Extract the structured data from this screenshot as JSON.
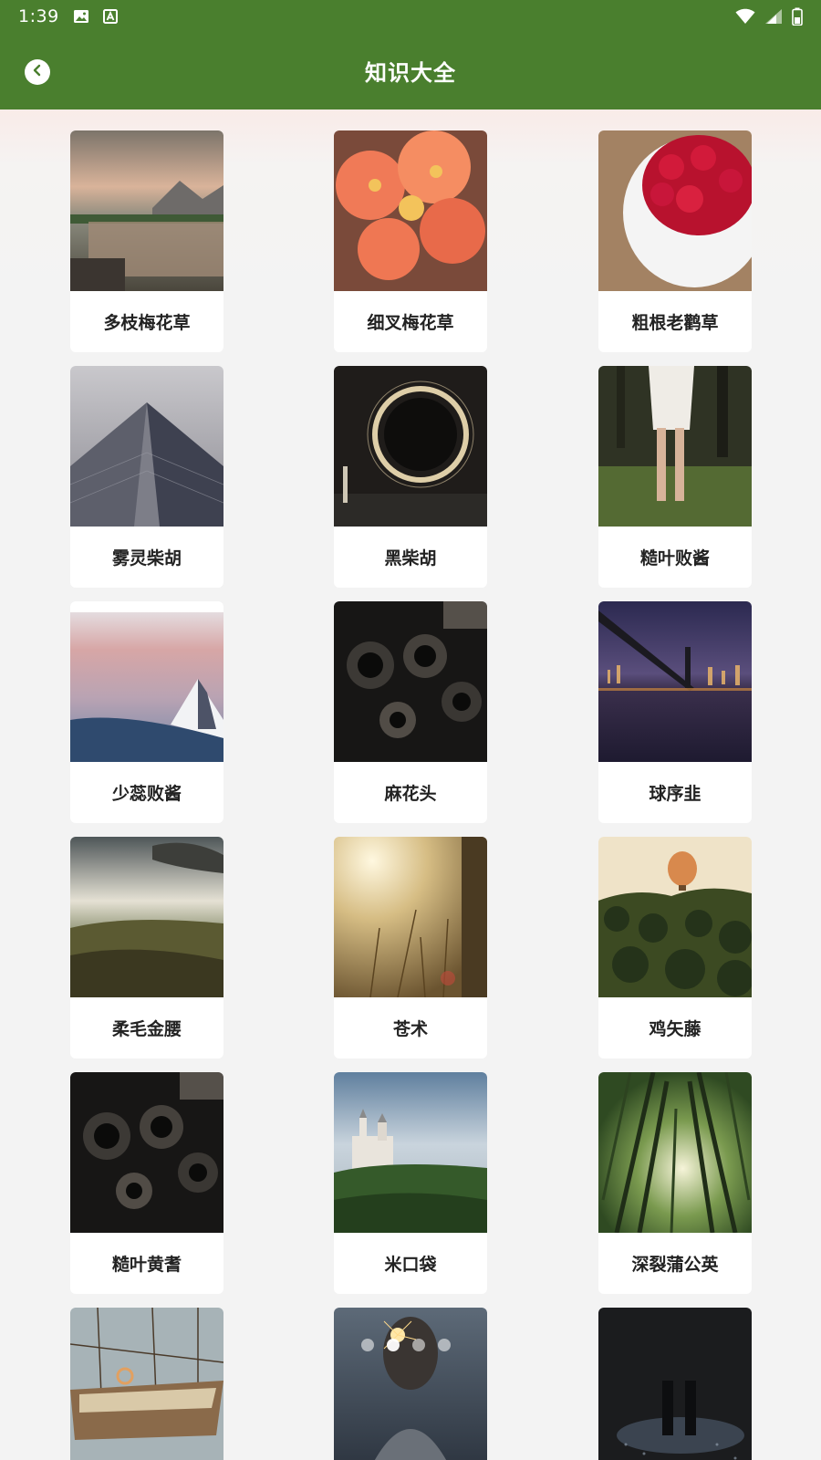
{
  "status_bar": {
    "time": "1:39",
    "left_icons": [
      "image-icon",
      "a-letter-icon"
    ],
    "right_icons": [
      "wifi-icon",
      "signal-icon",
      "battery-icon"
    ]
  },
  "header": {
    "title": "知识大全",
    "back_icon": "chevron-left-icon",
    "color": "#4a7f2e"
  },
  "items": [
    {
      "label": "多枝梅花草",
      "image": "mountain-lake-photo"
    },
    {
      "label": "细叉梅花草",
      "image": "orange-flowers-photo"
    },
    {
      "label": "粗根老鹳草",
      "image": "raspberries-bowl-photo"
    },
    {
      "label": "雾灵柴胡",
      "image": "skyscraper-photo"
    },
    {
      "label": "黑柴胡",
      "image": "light-circle-photo"
    },
    {
      "label": "糙叶败酱",
      "image": "girl-forest-photo"
    },
    {
      "label": "少蕊败酱",
      "image": "snow-mountain-photo"
    },
    {
      "label": "麻花头",
      "image": "vintage-cameras-photo"
    },
    {
      "label": "球序韭",
      "image": "night-bridge-photo"
    },
    {
      "label": "柔毛金腰",
      "image": "green-hills-photo"
    },
    {
      "label": "苍术",
      "image": "sunlit-grass-photo"
    },
    {
      "label": "鸡矢藤",
      "image": "hot-air-balloon-photo"
    },
    {
      "label": "糙叶黄耆",
      "image": "vintage-cameras-photo"
    },
    {
      "label": "米口袋",
      "image": "castle-photo"
    },
    {
      "label": "深裂蒲公英",
      "image": "bamboo-forest-photo"
    },
    {
      "label": "",
      "image": "sailboat-photo"
    },
    {
      "label": "",
      "image": "sparkler-photo"
    },
    {
      "label": "",
      "image": "dark-couple-photo"
    }
  ],
  "pager": {
    "count": 4,
    "active": 1
  }
}
